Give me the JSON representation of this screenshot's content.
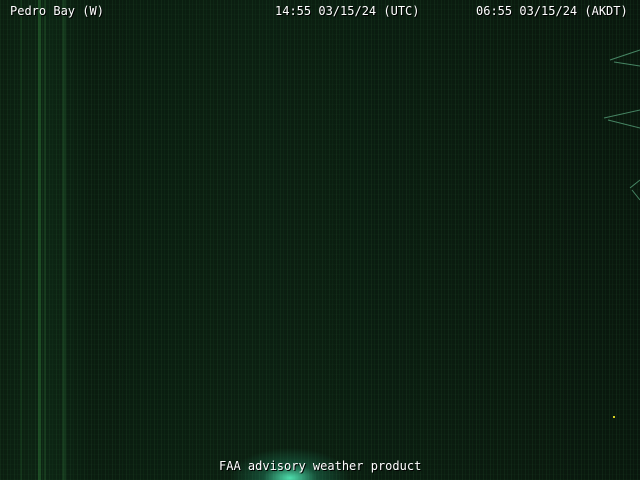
{
  "overlay": {
    "station_name": "Pedro Bay (W)",
    "utc_timestamp": "14:55 03/15/24 (UTC)",
    "local_timestamp": "06:55 03/15/24 (AKDT)",
    "footer_text": "FAA advisory weather product"
  }
}
